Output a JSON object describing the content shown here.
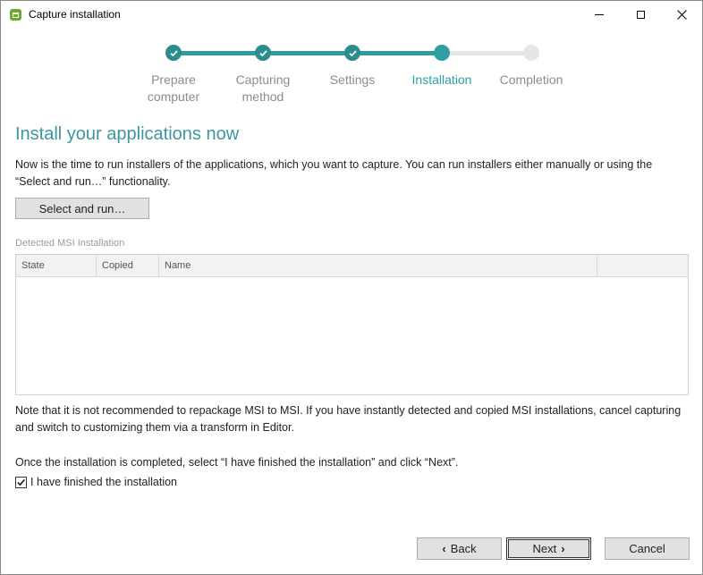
{
  "window": {
    "title": "Capture installation"
  },
  "stepper": {
    "steps": [
      {
        "label_line1": "Prepare",
        "label_line2": "computer",
        "state": "done"
      },
      {
        "label_line1": "Capturing",
        "label_line2": "method",
        "state": "done"
      },
      {
        "label_line1": "Settings",
        "label_line2": "",
        "state": "done"
      },
      {
        "label_line1": "Installation",
        "label_line2": "",
        "state": "active"
      },
      {
        "label_line1": "Completion",
        "label_line2": "",
        "state": "todo"
      }
    ]
  },
  "main": {
    "heading": "Install your applications now",
    "intro": "Now is the time to run installers of the applications, which you want to capture. You can run installers either manually or using the “Select and run…” functionality.",
    "select_run_label": "Select and run…",
    "section_label": "Detected MSI Installation",
    "table": {
      "columns": [
        "State",
        "Copied",
        "Name",
        ""
      ],
      "rows": []
    },
    "note": "Note that it is not recommended to repackage MSI to MSI. If you have instantly detected and copied MSI installations, cancel capturing and switch to customizing them via a transform in Editor.",
    "instruction": "Once the installation is completed, select “I have finished the installation” and click “Next”.",
    "finished_checkbox": {
      "label": "I have finished the installation",
      "checked": true
    }
  },
  "footer": {
    "back_label": "Back",
    "next_label": "Next",
    "cancel_label": "Cancel"
  },
  "colors": {
    "accent": "#2e9ea0",
    "heading": "#3c96a0",
    "inactive_step": "#e5e5e5"
  }
}
